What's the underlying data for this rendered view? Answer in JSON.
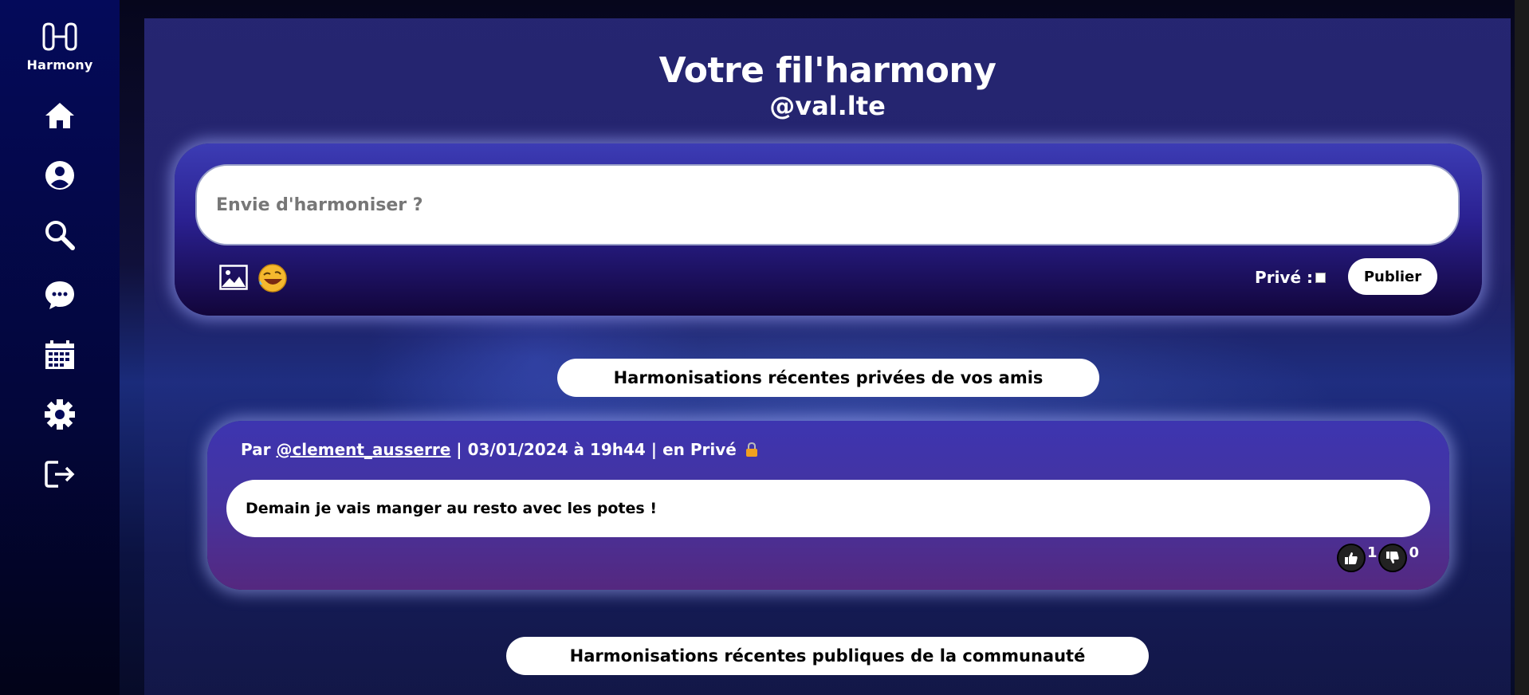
{
  "sidebar": {
    "logo_text": "Harmony",
    "items": [
      {
        "icon": "home-icon",
        "label": "home"
      },
      {
        "icon": "profile-icon",
        "label": "profile"
      },
      {
        "icon": "search-icon",
        "label": "search"
      },
      {
        "icon": "chat-icon",
        "label": "messages"
      },
      {
        "icon": "calendar-icon",
        "label": "calendar"
      },
      {
        "icon": "gear-icon",
        "label": "settings"
      },
      {
        "icon": "logout-icon",
        "label": "logout"
      }
    ]
  },
  "header": {
    "title": "Votre fil'harmony",
    "handle": "@val.lte"
  },
  "composer": {
    "placeholder": "Envie d'harmoniser ?",
    "value": "",
    "private_label": "Privé :",
    "publish_label": "Publier"
  },
  "sections": {
    "private_feed": "Harmonisations récentes privées de vos amis",
    "public_feed": "Harmonisations récentes publiques de la communauté"
  },
  "posts": [
    {
      "prefix": "Par ",
      "author": "@clement_ausserre",
      "meta_rest": " | 03/01/2024 à 19h44 | en Privé",
      "body": "Demain je vais manger au resto avec les potes !",
      "likes": "1",
      "dislikes": "0"
    }
  ],
  "colors": {
    "sidebar_bg": "#040a5a",
    "panel_bg": "#28287a",
    "accent": "#3c3cb4"
  }
}
